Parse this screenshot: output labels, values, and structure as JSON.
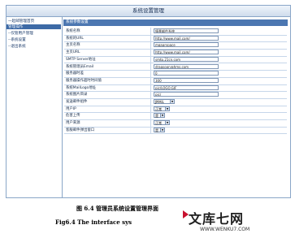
{
  "window": {
    "title": "系统设置管理"
  },
  "sidebar": {
    "items": [
      {
        "label": "一起邮管理首页",
        "active": false
      },
      {
        "label": "管理操作",
        "active": true
      },
      {
        "label": "--仅管用户管理",
        "active": false
      },
      {
        "label": "--系统设置",
        "active": false
      },
      {
        "label": "--退出系统",
        "active": false
      }
    ]
  },
  "form": {
    "section_header": "系统参数设置",
    "rows": [
      {
        "label": "系统名称",
        "type": "text",
        "value": "情景邮件系统"
      },
      {
        "label": "系统的URL",
        "type": "text",
        "value": "http://www.mail.com/"
      },
      {
        "label": "主页名称",
        "type": "text",
        "value": "mgaarspace"
      },
      {
        "label": "主页URL",
        "type": "text",
        "value": "http://www.mail.com/"
      },
      {
        "label": "SMTP Server地址",
        "type": "text",
        "value": "smtp.21cn.com"
      },
      {
        "label": "系统管理员Email",
        "type": "text",
        "value": "dragsoon@hms.com"
      },
      {
        "label": "服务器时差",
        "type": "text",
        "value": "0"
      },
      {
        "label": "服务器操作超时时间值",
        "type": "text",
        "value": "300"
      },
      {
        "label": "系统MailLogo地址",
        "type": "text",
        "value": "pic/LOGO.GIF"
      },
      {
        "label": "系统图片目录",
        "type": "text",
        "value": "pic/"
      },
      {
        "label": "发送邮件组件",
        "type": "select",
        "value": "JMAIL"
      },
      {
        "label": "用户IP",
        "type": "select",
        "value": "正常"
      },
      {
        "label": "危害上传",
        "type": "select",
        "value": "是"
      },
      {
        "label": "用户来源",
        "type": "select",
        "value": "正常"
      },
      {
        "label": "客服邮件弹出窗口",
        "type": "select",
        "value": "是"
      }
    ]
  },
  "figure": {
    "caption_cn": "图 6.4 管理员系统设置管理界面",
    "caption_en": "Fig6.4 The interface sys"
  },
  "watermark": {
    "logo_text": "文库七网",
    "url": "WWW.WENKU7.COM"
  }
}
